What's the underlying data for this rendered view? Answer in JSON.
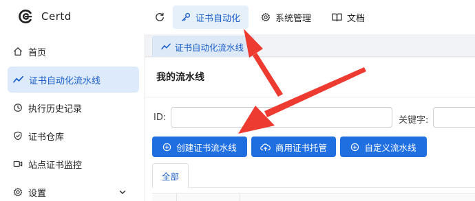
{
  "app": {
    "brand": "Certd"
  },
  "topnav": [
    {
      "label": "证书自动化",
      "icon": "key-icon",
      "active": true
    },
    {
      "label": "系统管理",
      "icon": "gear-icon",
      "active": false
    },
    {
      "label": "文档",
      "icon": "book-icon",
      "active": false
    }
  ],
  "sidebar": {
    "items": [
      {
        "label": "首页",
        "icon": "home-icon"
      },
      {
        "label": "证书自动化流水线",
        "icon": "trend-icon",
        "active": true
      },
      {
        "label": "执行历史记录",
        "icon": "history-icon"
      },
      {
        "label": "证书仓库",
        "icon": "shield-icon"
      },
      {
        "label": "站点证书监控",
        "icon": "video-icon"
      },
      {
        "label": "设置",
        "icon": "gear-icon"
      }
    ]
  },
  "tab": {
    "label": "证书自动化流水线"
  },
  "page": {
    "title": "我的流水线"
  },
  "search": {
    "id_label": "ID:",
    "id_value": "",
    "keyword_label": "关键字:",
    "keyword_value": ""
  },
  "actions": {
    "create": "创建证书流水线",
    "upload": "商用证书托管",
    "custom": "自定义流水线"
  },
  "filter_tabs": {
    "all": "全部"
  },
  "colors": {
    "primary": "#1f6fe0",
    "active_bg": "#dceafb",
    "arrow": "#ee3b32"
  }
}
